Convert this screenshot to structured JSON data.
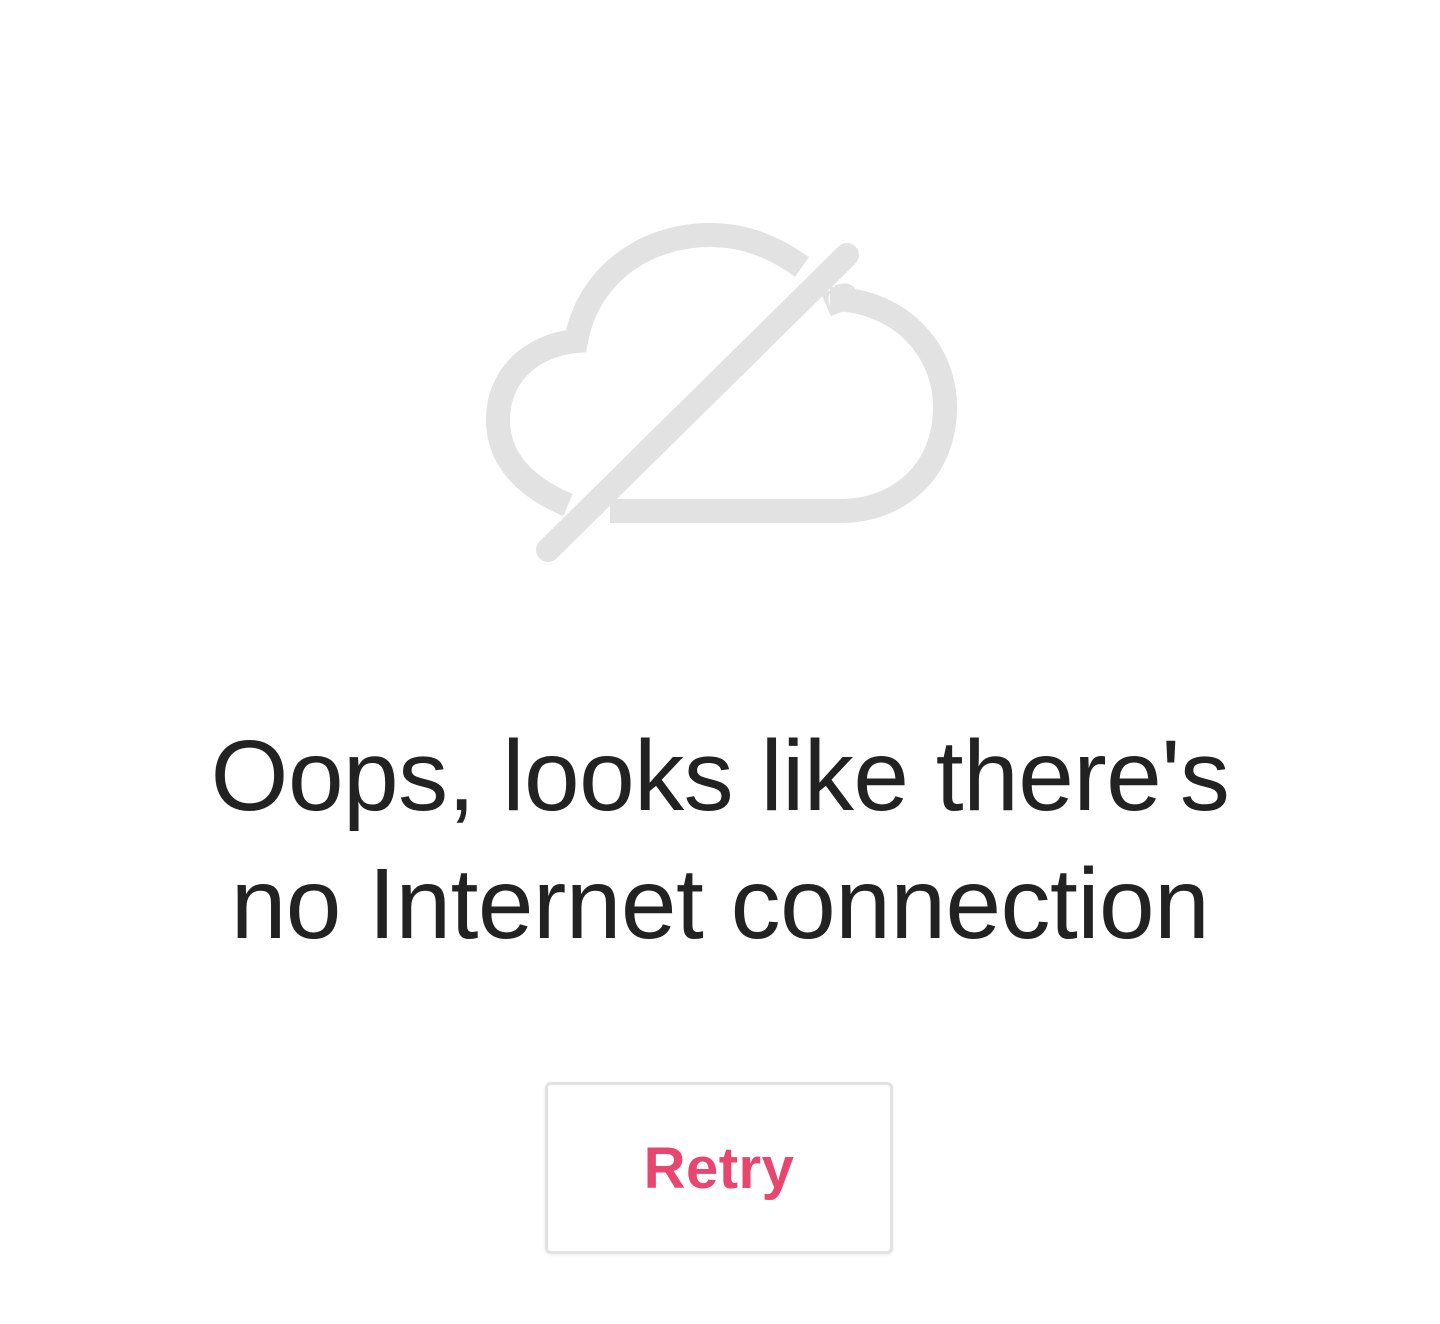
{
  "icon": {
    "name": "cloud-off-icon",
    "color": "#e2e2e2"
  },
  "message": {
    "line1": "Oops, looks like there's",
    "line2": "no Internet connection",
    "color": "#222222"
  },
  "retry_button": {
    "label": "Retry",
    "color": "#e8456f",
    "border_color": "#e2e2e2"
  }
}
